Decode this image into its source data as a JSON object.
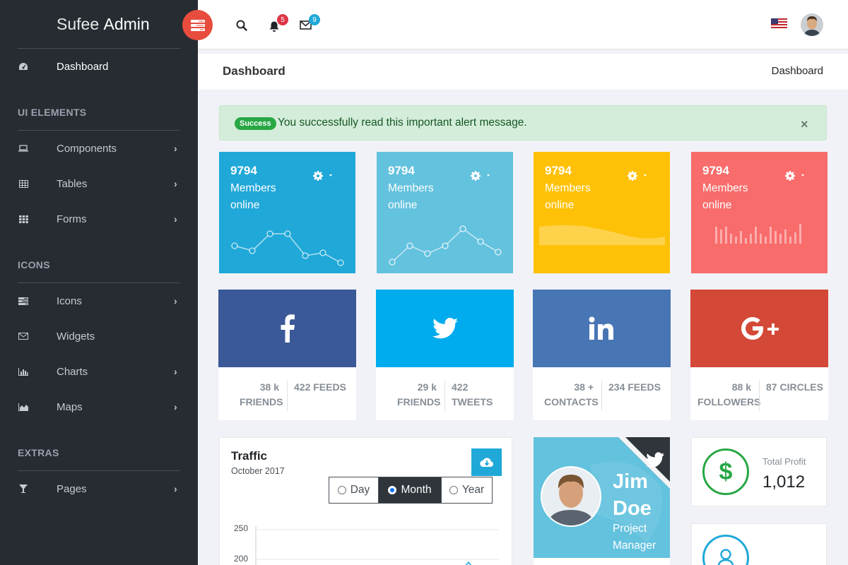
{
  "brand": {
    "light": "Sufee",
    "bold": "Admin"
  },
  "sidebar": {
    "dashboard": "Dashboard",
    "sections": [
      "UI ELEMENTS",
      "ICONS",
      "EXTRAS"
    ],
    "items": [
      {
        "label": "Components",
        "icon": "laptop-icon"
      },
      {
        "label": "Tables",
        "icon": "table-icon"
      },
      {
        "label": "Forms",
        "icon": "grid-icon"
      },
      {
        "label": "Icons",
        "icon": "tasks-icon"
      },
      {
        "label": "Widgets",
        "icon": "envelope-icon"
      },
      {
        "label": "Charts",
        "icon": "bar-chart-icon"
      },
      {
        "label": "Maps",
        "icon": "area-chart-icon"
      },
      {
        "label": "Pages",
        "icon": "glass-icon"
      }
    ]
  },
  "topbar": {
    "notifications": "5",
    "messages": "9"
  },
  "page": {
    "title": "Dashboard",
    "breadcrumb": "Dashboard"
  },
  "alert": {
    "badge": "Success",
    "message": "You successfully read this important alert message.",
    "close": "×"
  },
  "stat_cards": [
    {
      "value": "9794",
      "label": "Members online",
      "color": "#20a8d8"
    },
    {
      "value": "9794",
      "label": "Members online",
      "color": "#63c2de"
    },
    {
      "value": "9794",
      "label": "Members online",
      "color": "#ffc107"
    },
    {
      "value": "9794",
      "label": "Members online",
      "color": "#f86c6b"
    }
  ],
  "social": [
    {
      "network": "facebook",
      "color": "#3b5998",
      "a_val": "38 k",
      "a_lbl": "FRIENDS",
      "b_val": "422",
      "b_lbl": "FEEDS"
    },
    {
      "network": "twitter",
      "color": "#00aced",
      "a_val": "29 k",
      "a_lbl": "FRIENDS",
      "b_val": "422",
      "b_lbl": "TWEETS"
    },
    {
      "network": "linkedin",
      "color": "#4875b4",
      "a_val": "38 +",
      "a_lbl": "CONTACTS",
      "b_val": "234",
      "b_lbl": "FEEDS"
    },
    {
      "network": "google-plus",
      "color": "#d34836",
      "a_val": "88 k",
      "a_lbl": "FOLLOWERS",
      "b_val": "87",
      "b_lbl": "CIRCLES"
    }
  ],
  "traffic": {
    "title": "Traffic",
    "subtitle": "October 2017",
    "ranges": [
      "Day",
      "Month",
      "Year"
    ],
    "selected": "Month",
    "y_ticks": [
      "250",
      "200"
    ]
  },
  "profile": {
    "first": "Jim",
    "last": "Doe",
    "role1": "Project",
    "role2": "Manager"
  },
  "profit": {
    "label": "Total Profit",
    "value": "1,012"
  }
}
